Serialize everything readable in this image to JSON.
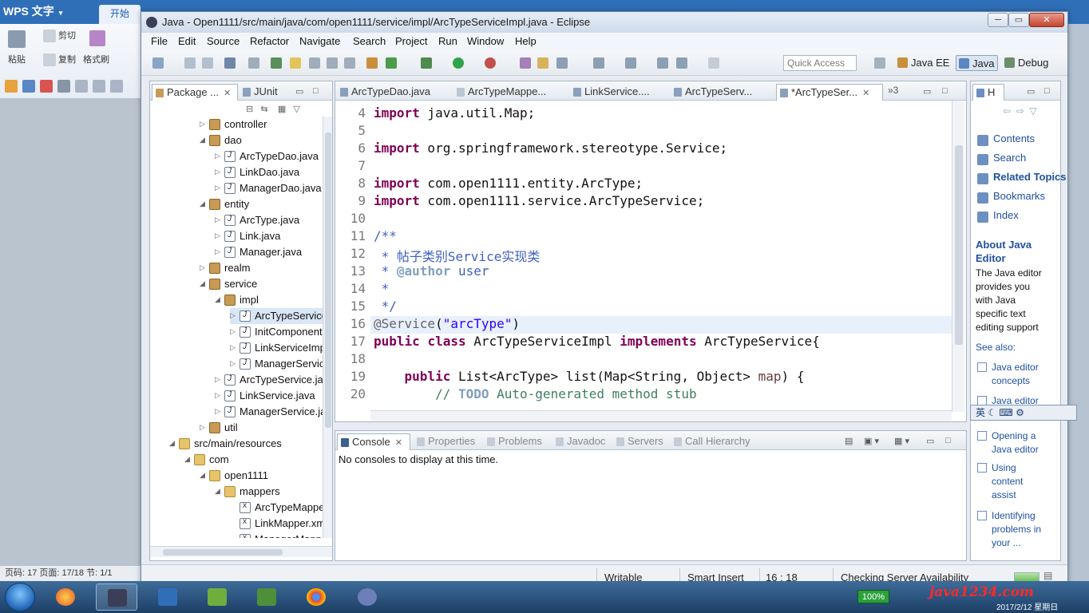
{
  "wps": {
    "logo": "WPS 文字",
    "tab_start": "开始",
    "paste": "粘贴",
    "cut": "剪切",
    "copy": "复制",
    "format_painter": "格式刷",
    "status": "页码: 17   页面: 17/18   节: 1/1"
  },
  "window": {
    "title": "Java - Open1111/src/main/java/com/open1111/service/impl/ArcTypeServiceImpl.java - Eclipse",
    "min": "─",
    "max": "▭",
    "close": "✕"
  },
  "menu": [
    "File",
    "Edit",
    "Source",
    "Refactor",
    "Navigate",
    "Search",
    "Project",
    "Run",
    "Window",
    "Help"
  ],
  "toolbar": {
    "quick_access_placeholder": "Quick Access",
    "perspectives": [
      "Java EE",
      "Java",
      "Debug"
    ]
  },
  "package_explorer": {
    "tabs": [
      "Package ...",
      "JUnit"
    ],
    "rows": [
      {
        "label": "controller",
        "icon": "package",
        "indent": 0,
        "arrow": "▷"
      },
      {
        "label": "dao",
        "icon": "package",
        "indent": 0,
        "arrow": "◢"
      },
      {
        "label": "ArcTypeDao.java",
        "icon": "java",
        "indent": 1,
        "arrow": "▷"
      },
      {
        "label": "LinkDao.java",
        "icon": "java",
        "indent": 1,
        "arrow": "▷"
      },
      {
        "label": "ManagerDao.java",
        "icon": "java",
        "indent": 1,
        "arrow": "▷"
      },
      {
        "label": "entity",
        "icon": "package",
        "indent": 0,
        "arrow": "◢"
      },
      {
        "label": "ArcType.java",
        "icon": "java",
        "indent": 1,
        "arrow": "▷"
      },
      {
        "label": "Link.java",
        "icon": "java",
        "indent": 1,
        "arrow": "▷"
      },
      {
        "label": "Manager.java",
        "icon": "java",
        "indent": 1,
        "arrow": "▷"
      },
      {
        "label": "realm",
        "icon": "package",
        "indent": 0,
        "arrow": "▷"
      },
      {
        "label": "service",
        "icon": "package",
        "indent": 0,
        "arrow": "◢"
      },
      {
        "label": "impl",
        "icon": "package",
        "indent": 1,
        "arrow": "◢"
      },
      {
        "label": "ArcTypeServiceImpl.java",
        "icon": "java",
        "indent": 2,
        "arrow": "▷",
        "selected": true
      },
      {
        "label": "InitComponent.java",
        "icon": "java",
        "indent": 2,
        "arrow": "▷"
      },
      {
        "label": "LinkServiceImpl.java",
        "icon": "java",
        "indent": 2,
        "arrow": "▷"
      },
      {
        "label": "ManagerServiceImpl.java",
        "icon": "java",
        "indent": 2,
        "arrow": "▷"
      },
      {
        "label": "ArcTypeService.java",
        "icon": "java",
        "indent": 1,
        "arrow": "▷"
      },
      {
        "label": "LinkService.java",
        "icon": "java",
        "indent": 1,
        "arrow": "▷"
      },
      {
        "label": "ManagerService.java",
        "icon": "java",
        "indent": 1,
        "arrow": "▷"
      },
      {
        "label": "util",
        "icon": "package",
        "indent": 0,
        "arrow": "▷"
      },
      {
        "label": "src/main/resources",
        "icon": "folder",
        "indent": -2,
        "arrow": "◢"
      },
      {
        "label": "com",
        "icon": "folder",
        "indent": -1,
        "arrow": "◢"
      },
      {
        "label": "open1111",
        "icon": "folder",
        "indent": 0,
        "arrow": "◢"
      },
      {
        "label": "mappers",
        "icon": "folder",
        "indent": 1,
        "arrow": "◢"
      },
      {
        "label": "ArcTypeMapper.xml",
        "icon": "xml",
        "indent": 2,
        "arrow": ""
      },
      {
        "label": "LinkMapper.xml",
        "icon": "xml",
        "indent": 2,
        "arrow": ""
      },
      {
        "label": "ManagerMapper.xml",
        "icon": "xml",
        "indent": 2,
        "arrow": ""
      }
    ]
  },
  "editor": {
    "tabs": [
      "ArcTypeDao.java",
      "ArcTypeMappe...",
      "LinkService....",
      "ArcTypeServ...",
      "*ArcTypeSer..."
    ],
    "overflow": "»3",
    "active_tab": 4,
    "lines": [
      {
        "n": "4",
        "html": "<span class='kw'>import</span> java.util.Map;"
      },
      {
        "n": "5",
        "html": ""
      },
      {
        "n": "6",
        "html": "<span class='kw'>import</span> org.springframework.stereotype.Service;"
      },
      {
        "n": "7",
        "html": ""
      },
      {
        "n": "8",
        "html": "<span class='kw'>import</span> com.open1111.entity.ArcType;"
      },
      {
        "n": "9",
        "html": "<span class='kw'>import</span> com.open1111.service.ArcTypeService;"
      },
      {
        "n": "10",
        "html": ""
      },
      {
        "n": "11",
        "html": "<span class='cm'>/**</span>"
      },
      {
        "n": "12",
        "html": "<span class='cm'> * 帖子类别Service实现类</span>"
      },
      {
        "n": "13",
        "html": "<span class='cm'> * </span><span class='cmk'>@author</span><span class='cm'> user</span>"
      },
      {
        "n": "14",
        "html": "<span class='cm'> *</span>"
      },
      {
        "n": "15",
        "html": "<span class='cm'> */</span>"
      },
      {
        "n": "16",
        "html": "<span class='ann'>@Service</span>(<span class='str'>\"arcType\"</span>)",
        "current": true
      },
      {
        "n": "17",
        "html": "<span class='kw'>public</span> <span class='kw'>class</span> ArcTypeServiceImpl <span class='kw'>implements</span> ArcTypeService{"
      },
      {
        "n": "18",
        "html": ""
      },
      {
        "n": "19",
        "html": "    <span class='kw'>public</span> List&lt;ArcType&gt; list(Map&lt;String, Object&gt; <span class='pm'>map</span>) {"
      },
      {
        "n": "20",
        "html": "        <span class='lc'>// </span><span class='lct'>TODO</span><span class='lc'> Auto-generated method stub</span>"
      }
    ]
  },
  "help": {
    "tab": "H",
    "links": [
      "Contents",
      "Search",
      "Related Topics",
      "Bookmarks",
      "Index"
    ],
    "about_title": "About Java Editor",
    "about_desc": "The Java editor provides you with Java specific text editing support",
    "see_also": "See also:",
    "see_links": [
      "Java editor concepts",
      "Java editor ...",
      "Opening a Java editor",
      "Using content assist",
      "Identifying problems in your ..."
    ],
    "ime": "英 ☾ ⌨ ⚙"
  },
  "console": {
    "tabs": [
      "Console",
      "Properties",
      "Problems",
      "Javadoc",
      "Servers",
      "Call Hierarchy"
    ],
    "message": "No consoles to display at this time."
  },
  "status": {
    "writable": "Writable",
    "insert_mode": "Smart Insert",
    "position": "16 : 18",
    "task": "Checking Server Availability"
  },
  "taskbar": {
    "battery": "100%",
    "site": "java1234.com",
    "date": "2017/2/12 星期日"
  }
}
